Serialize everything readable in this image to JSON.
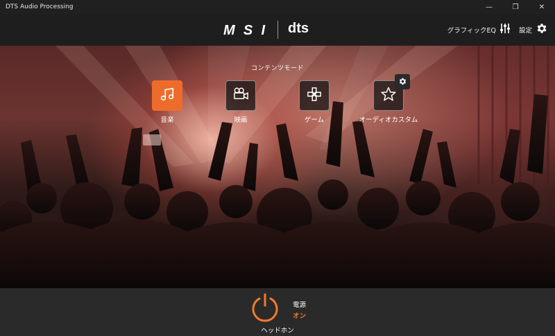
{
  "window": {
    "title": "DTS Audio Processing",
    "controls": [
      "—",
      "❐",
      "✕"
    ]
  },
  "header": {
    "brand_msi": "MSI",
    "brand_dts": "dts",
    "graphic_eq_label": "グラフィックEQ",
    "settings_label": "設定"
  },
  "content": {
    "title": "コンテンツモード",
    "modes": [
      {
        "label": "音楽",
        "icon": "music-note-icon",
        "active": true
      },
      {
        "label": "映画",
        "icon": "movie-camera-icon",
        "active": false
      },
      {
        "label": "ゲーム",
        "icon": "gamepad-icon",
        "active": false
      },
      {
        "label": "オーディオカスタム",
        "icon": "star-icon",
        "active": false
      }
    ]
  },
  "footer": {
    "power_label": "電源",
    "power_state": "オン",
    "device": "ヘッドホン"
  },
  "colors": {
    "accent": "#ee6c2b",
    "power_state": "#ef7a2d",
    "header_bg": "#1f1e1e",
    "footer_bg": "#2b2a2a"
  }
}
